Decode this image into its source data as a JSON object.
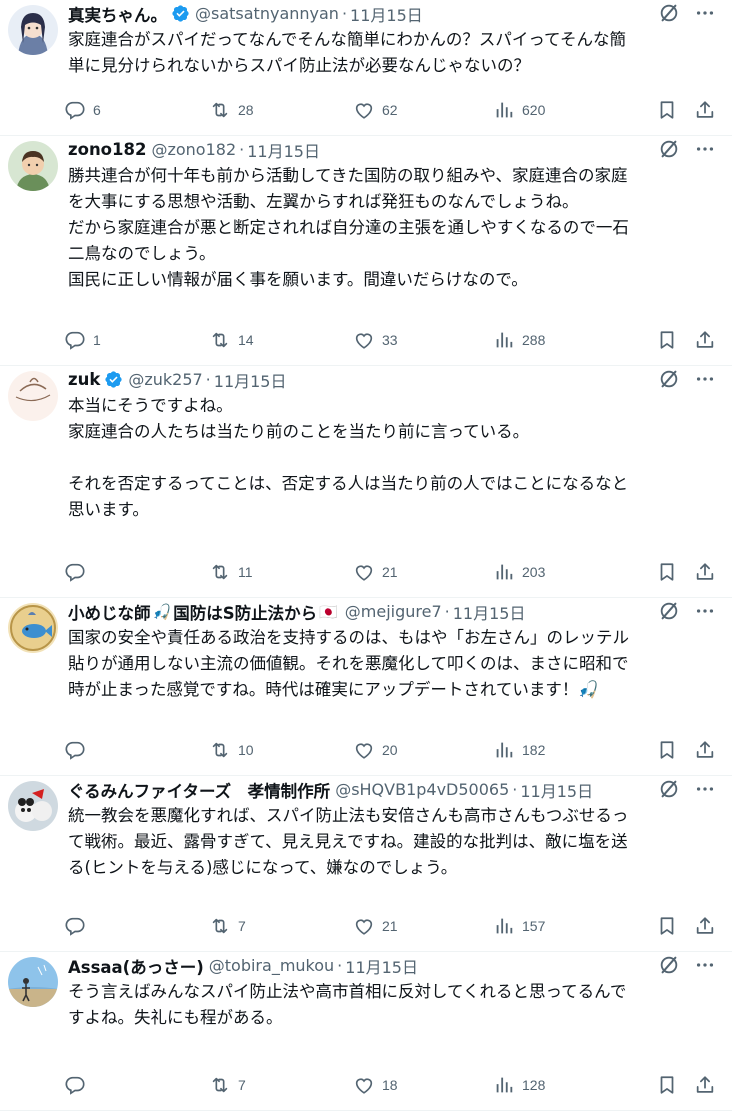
{
  "tweets": [
    {
      "name": "真実ちゃん。",
      "verified": true,
      "handle": "@satsatnyannyan",
      "time": "11月15日",
      "text": "家庭連合がスパイだってなんでそんな簡単にわかんの？スパイってそんな簡\n単に見分けられないからスパイ防止法が必要なんじゃないの？",
      "replies": "6",
      "reposts": "28",
      "likes": "62",
      "views": "620"
    },
    {
      "name": "zono182",
      "verified": false,
      "handle": "@zono182",
      "time": "11月15日",
      "text": "勝共連合が何十年も前から活動してきた国防の取り組みや、家庭連合の家庭\nを大事にする思想や活動、左翼からすれば発狂ものなんでしょうね。\nだから家庭連合が悪と断定されれば自分達の主張を通しやすくなるので一石\n二鳥なのでしょう。\n国民に正しい情報が届く事を願います。間違いだらけなので。",
      "replies": "1",
      "reposts": "14",
      "likes": "33",
      "views": "288"
    },
    {
      "name": "zuk",
      "verified": true,
      "handle": "@zuk257",
      "time": "11月15日",
      "text": "本当にそうですよね。\n家庭連合の人たちは当たり前のことを当たり前に言っている。\n\nそれを否定するってことは、否定する人は当たり前の人ではことになるなと\n思います。",
      "replies": "",
      "reposts": "11",
      "likes": "21",
      "views": "203"
    },
    {
      "name": "小めじな師",
      "name_emoji": "🎣",
      "name_suffix": "国防はS防止法から",
      "flag": "🇯🇵",
      "verified": false,
      "handle": "@mejigure7",
      "time": "11月15日",
      "text": "国家の安全や責任ある政治を支持するのは、もはや「お左さん」のレッテル\n貼りが通用しない主流の価値観。それを悪魔化して叩くのは、まさに昭和で\n時が止まった感覚ですね。時代は確実にアップデートされています！🎣",
      "replies": "",
      "reposts": "10",
      "likes": "20",
      "views": "182"
    },
    {
      "name": "ぐるみんファイターズ　孝情制作所",
      "verified": false,
      "handle": "@sHQVB1p4vD50065",
      "time": "11月15日",
      "text": "統一教会を悪魔化すれば、スパイ防止法も安倍さんも高市さんもつぶせるっ\nて戦術。最近、露骨すぎて、見え見えですね。建設的な批判は、敵に塩を送\nる(ヒントを与える)感じになって、嫌なのでしょう。",
      "replies": "",
      "reposts": "7",
      "likes": "21",
      "views": "157"
    },
    {
      "name": "Assaa(あっさー)",
      "verified": false,
      "handle": "@tobira_mukou",
      "time": "11月15日",
      "text": "そう言えばみんなスパイ防止法や高市首相に反対してくれると思ってるんで\nすよね。失礼にも程がある。",
      "replies": "",
      "reposts": "7",
      "likes": "18",
      "views": "128"
    }
  ],
  "dot": "·",
  "colors": {
    "verified": "#1d9bf0",
    "secondary": "#536471",
    "text": "#0f1419",
    "divider": "#eff3f4"
  }
}
